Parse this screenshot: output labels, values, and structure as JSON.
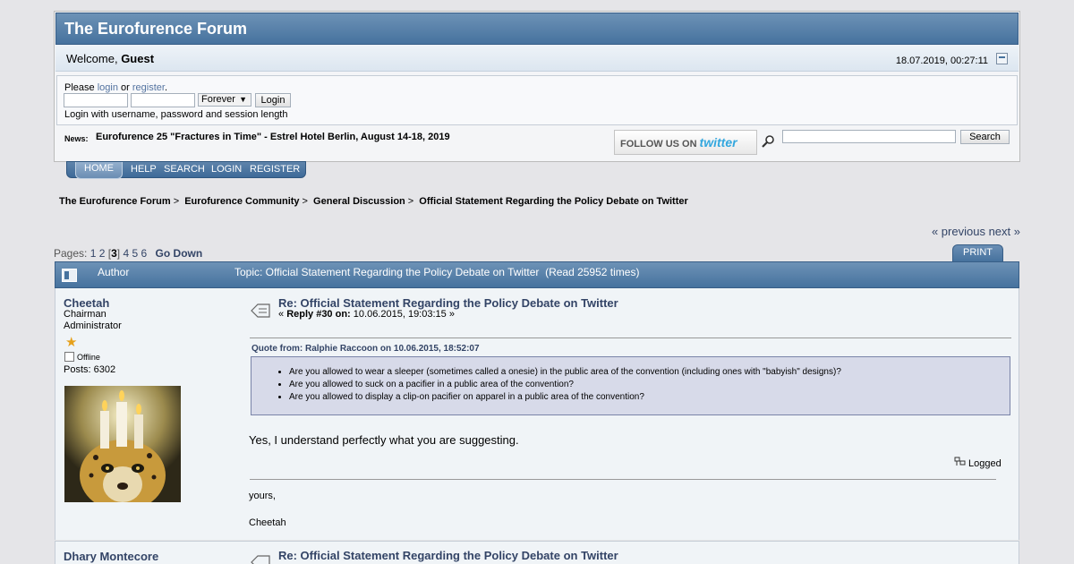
{
  "header": {
    "forum_title": "The Eurofurence Forum",
    "welcome_prefix": "Welcome,",
    "user": "Guest",
    "datetime": "18.07.2019, 00:27:11"
  },
  "login": {
    "please": "Please",
    "login_link": "login",
    "or": "or",
    "register_link": "register",
    "period": ".",
    "duration": "Forever",
    "login_button": "Login",
    "hint": "Login with username, password and session length"
  },
  "news": {
    "label": "News:",
    "text": "Eurofurence 25 \"Fractures in Time\" - Estrel Hotel Berlin, August 14-18, 2019"
  },
  "twitter": {
    "follow": "FOLLOW US ON",
    "brand": "twitter"
  },
  "search": {
    "button": "Search"
  },
  "menu": [
    "HOME",
    "HELP",
    "SEARCH",
    "LOGIN",
    "REGISTER"
  ],
  "breadcrumb": [
    "The Eurofurence Forum",
    "Eurofurence Community",
    "General Discussion",
    "Official Statement Regarding the Policy Debate on Twitter"
  ],
  "nav": {
    "previous": "« previous",
    "next": "next »",
    "print": "PRINT"
  },
  "pagination": {
    "label": "Pages:",
    "pages": [
      "1",
      "2",
      "3",
      "4",
      "5",
      "6"
    ],
    "current": "3",
    "go_down": "Go Down"
  },
  "topic_bar": {
    "author_col": "Author",
    "topic": "Topic: Official Statement Regarding the Policy Debate on Twitter  (Read 25952 times)"
  },
  "posts": [
    {
      "author": "Cheetah",
      "title": "Chairman",
      "group": "Administrator",
      "status": "Offline",
      "posts": "Posts: 6302",
      "subject": "Re: Official Statement Regarding the Policy Debate on Twitter",
      "reply_label": "Reply #30 on:",
      "reply_date": "10.06.2015, 19:03:15 »",
      "quote_header": "Quote from: Ralphie Raccoon on 10.06.2015, 18:52:07",
      "quote_items": [
        "Are you allowed to wear a sleeper (sometimes called a onesie) in the public area of the convention (including ones with \"babyish\" designs)?",
        "Are you allowed to suck on a pacifier in a public area of the convention?",
        "Are you allowed to display a clip-on pacifier on apparel in a public area of the convention?"
      ],
      "body": "Yes, I understand perfectly what you are suggesting.",
      "logged": "Logged",
      "signature": [
        "yours,",
        "Cheetah"
      ]
    },
    {
      "author": "Dhary Montecore",
      "subject": "Re: Official Statement Regarding the Policy Debate on Twitter"
    }
  ]
}
